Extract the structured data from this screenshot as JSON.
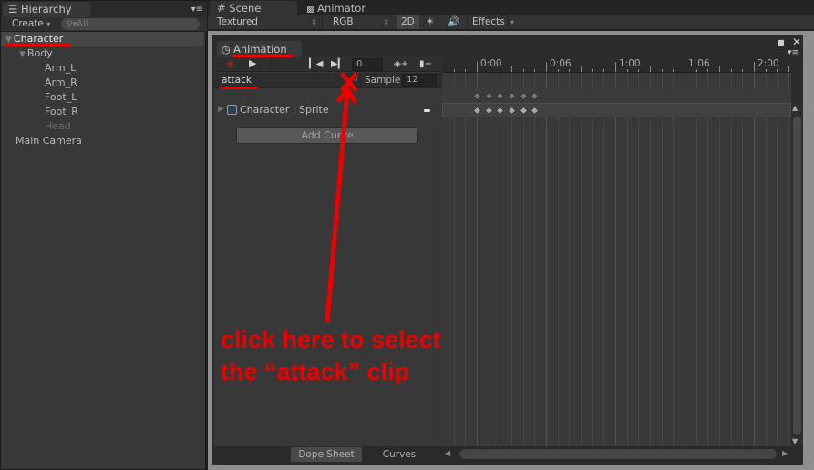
{
  "hierarchy": {
    "tab_label": "Hierarchy",
    "create_label": "Create",
    "search_placeholder": "All",
    "items": [
      {
        "label": "Character",
        "selected": true
      },
      {
        "label": "Body"
      },
      {
        "label": "Arm_L"
      },
      {
        "label": "Arm_R"
      },
      {
        "label": "Foot_L"
      },
      {
        "label": "Foot_R"
      },
      {
        "label": "Head",
        "inactive": true
      },
      {
        "label": "Main Camera"
      }
    ]
  },
  "scene": {
    "tabs": [
      "Scene",
      "Animator"
    ],
    "toolbar": {
      "shading_mode": "Textured",
      "render_mode": "RGB",
      "mode_2d": "2D",
      "effects_label": "Effects"
    }
  },
  "animation": {
    "tab_label": "Animation",
    "frame_value": "0",
    "clip_name": "attack",
    "sample_label": "Sample",
    "sample_value": "12",
    "property_label": "Character : Sprite",
    "add_curve_label": "Add Curve",
    "ruler_labels": [
      "0:00",
      "0:06",
      "1:00",
      "1:06",
      "2:00"
    ],
    "keyframe_count": 6,
    "bottom_tabs": [
      "Dope Sheet",
      "Curves"
    ]
  },
  "annotation": {
    "text_line1": "click here to select",
    "text_line2": "the “attack” clip",
    "color": "#ee0000"
  }
}
